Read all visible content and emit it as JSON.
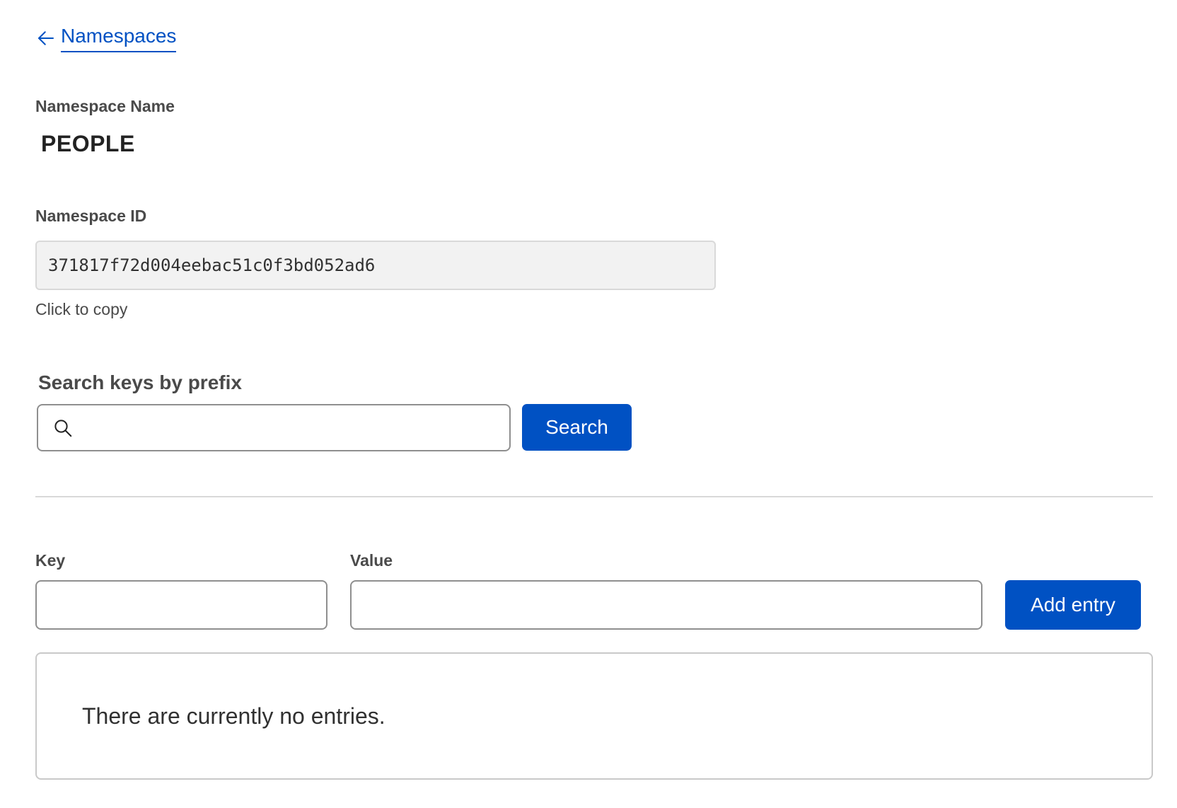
{
  "nav": {
    "back_label": "Namespaces"
  },
  "namespace": {
    "name_label": "Namespace Name",
    "name": "PEOPLE",
    "id_label": "Namespace ID",
    "id": "371817f72d004eebac51c0f3bd052ad6",
    "copy_hint": "Click to copy"
  },
  "search": {
    "label": "Search keys by prefix",
    "value": "",
    "placeholder": "",
    "button_label": "Search"
  },
  "entry_form": {
    "key_label": "Key",
    "value_label": "Value",
    "key_value": "",
    "value_value": "",
    "add_button_label": "Add entry"
  },
  "entries": {
    "empty_message": "There are currently no entries."
  },
  "colors": {
    "accent": "#0051c3",
    "text": "#313131"
  }
}
